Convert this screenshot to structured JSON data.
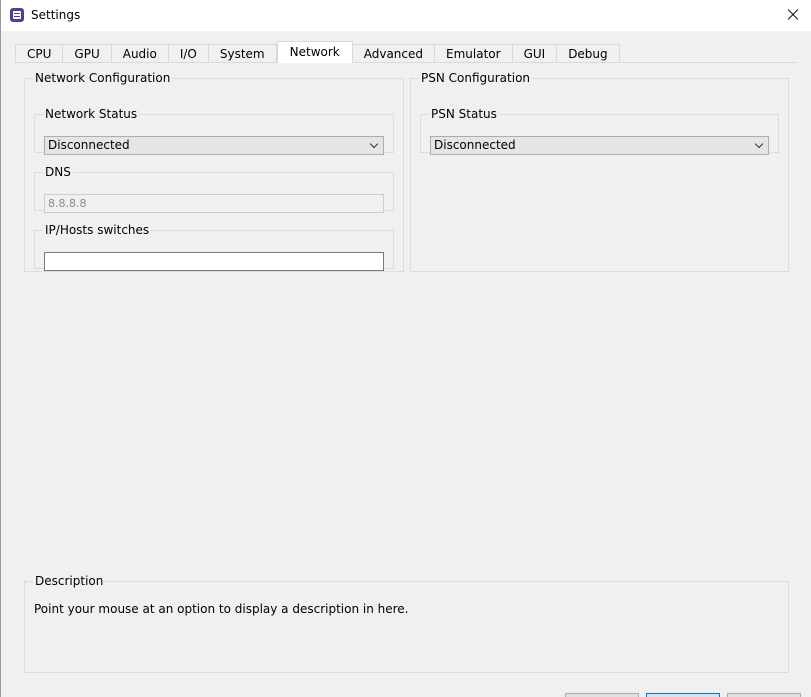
{
  "window": {
    "title": "Settings"
  },
  "tabs": [
    {
      "label": "CPU"
    },
    {
      "label": "GPU"
    },
    {
      "label": "Audio"
    },
    {
      "label": "I/O"
    },
    {
      "label": "System"
    },
    {
      "label": "Network",
      "active": true
    },
    {
      "label": "Advanced"
    },
    {
      "label": "Emulator"
    },
    {
      "label": "GUI"
    },
    {
      "label": "Debug"
    }
  ],
  "network": {
    "group_title": "Network Configuration",
    "status": {
      "title": "Network Status",
      "value": "Disconnected"
    },
    "dns": {
      "title": "DNS",
      "value": "8.8.8.8"
    },
    "ip_hosts": {
      "title": "IP/Hosts switches",
      "value": ""
    }
  },
  "psn": {
    "group_title": "PSN Configuration",
    "status": {
      "title": "PSN Status",
      "value": "Disconnected"
    }
  },
  "description": {
    "title": "Description",
    "text": "Point your mouse at an option to display a description in here."
  },
  "icons": {
    "app": "rpcs3-app-icon",
    "close": "close-icon",
    "dropdown": "chevron-down-icon"
  },
  "colors": {
    "accent": "#0078d7",
    "app_icon": "#4b3f9a"
  }
}
